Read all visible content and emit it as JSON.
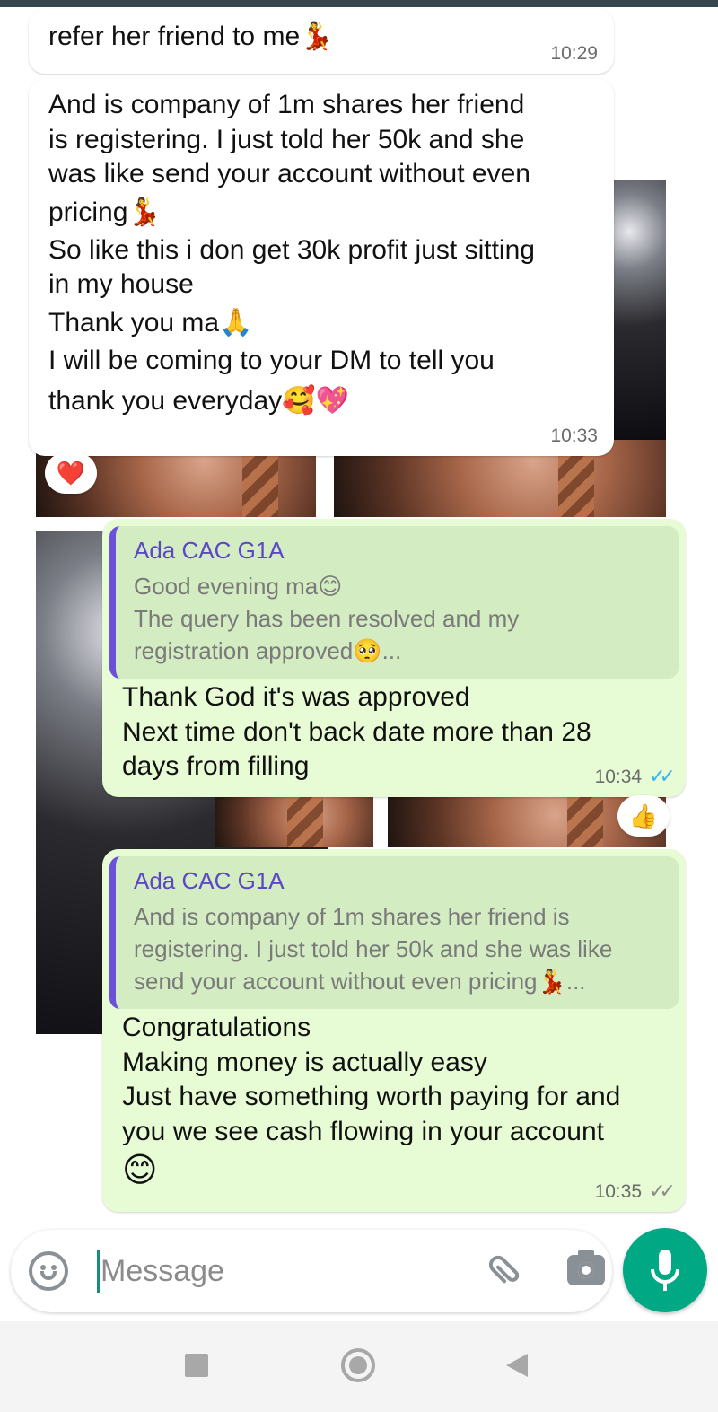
{
  "colors": {
    "incoming_bubble": "#ffffff",
    "outgoing_bubble": "#e7fbd4",
    "quote_bar": "#6b50d8",
    "quote_author": "#5b47c8",
    "read_ticks": "#34b7f1",
    "mic_button": "#00a884"
  },
  "messages": [
    {
      "direction": "incoming",
      "lines": [
        "refer her friend to me💃"
      ],
      "time": "10:29"
    },
    {
      "direction": "incoming",
      "lines": [
        "And is company of 1m shares her friend",
        "is registering. I just told her 50k and she",
        "was like send your account without even",
        "pricing💃",
        "So like this i don get 30k profit just sitting",
        "in my house",
        "Thank you ma🙏",
        "I will be coming to your DM to tell you",
        "thank you everyday🥰💖"
      ],
      "time": "10:33",
      "reaction": "❤️"
    },
    {
      "direction": "outgoing",
      "quote": {
        "author": "Ada CAC G1A",
        "lines": [
          "Good evening ma😊",
          "The query has been resolved and my",
          "registration approved🥺..."
        ]
      },
      "lines": [
        "Thank God it's was approved",
        "Next time don't back date more than 28",
        "days from filling"
      ],
      "time": "10:34",
      "status_icon": "read-ticks-icon",
      "ticks": "✓✓",
      "reaction": "👍"
    },
    {
      "direction": "outgoing",
      "quote": {
        "author": "Ada CAC G1A",
        "lines": [
          "And is company of 1m shares her friend is",
          "registering. I just told her 50k and she was like",
          "send your account without even pricing💃..."
        ]
      },
      "lines": [
        "Congratulations",
        "Making money is actually easy",
        "Just have something worth paying for and",
        "you we see cash flowing in your account",
        "😊"
      ],
      "time": "10:35",
      "status_icon": "delivered-ticks-icon",
      "ticks": "✓✓"
    }
  ],
  "composer": {
    "placeholder": "Message",
    "emoji_icon": "emoji-icon",
    "attach_icon": "attach-icon",
    "camera_icon": "camera-icon",
    "mic_icon": "mic-icon"
  },
  "navbar": {
    "recents_icon": "recents-icon",
    "home_icon": "home-icon",
    "back_icon": "back-icon"
  }
}
